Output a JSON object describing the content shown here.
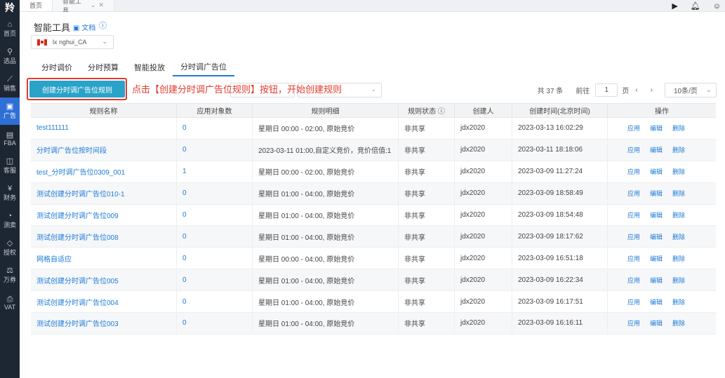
{
  "sidebar": {
    "logo": "羚",
    "items": [
      {
        "icon": "⌂",
        "label": "首页",
        "active": false
      },
      {
        "icon": "⚲",
        "label": "选品",
        "active": false
      },
      {
        "icon": "⟋",
        "label": "销售",
        "active": false
      },
      {
        "icon": "▣",
        "label": "广告",
        "active": true
      },
      {
        "icon": "▤",
        "label": "FBA",
        "active": false
      },
      {
        "icon": "◫",
        "label": "客服",
        "active": false
      },
      {
        "icon": "¥",
        "label": "财务",
        "active": false
      },
      {
        "icon": "◔",
        "label": "测卖",
        "active": false
      },
      {
        "icon": "◇",
        "label": "授权",
        "active": false
      },
      {
        "icon": "⚖",
        "label": "万券",
        "active": false
      },
      {
        "icon": "⎙",
        "label": "VAT",
        "active": false
      }
    ]
  },
  "topbar": {
    "tabs": [
      {
        "label": "首页"
      },
      {
        "label": "智能工具",
        "close": "✕"
      }
    ]
  },
  "page": {
    "title": "智能工具",
    "doc_link": "文档",
    "store_select": "lx nghui_CA"
  },
  "subtabs": [
    "分时调价",
    "分时预算",
    "智能投放",
    "分时调广告位"
  ],
  "toolbar": {
    "create_button": "创建分时调广告位规则",
    "annotation": "点击【创建分时调广告位规则】按钮，开始创建规则"
  },
  "pager": {
    "total": "共 37 条",
    "goto_label": "前往",
    "page_value": "1",
    "page_unit": "页",
    "prev": "‹",
    "next": "›",
    "page_size": "10条/页"
  },
  "table": {
    "headers": [
      "规则名称",
      "应用对象数",
      "规则明细",
      "规则状态 ⓘ",
      "创建人",
      "创建时间(北京时间)",
      "操作"
    ],
    "rows": [
      {
        "name": "test111111",
        "count": "0",
        "detail": "星期日 00:00 - 02:00, 原始竞价",
        "status": "非共享",
        "creator": "jdx2020",
        "created": "2023-03-13 16:02:29"
      },
      {
        "name": "分时调广告位按时间段",
        "count": "0",
        "detail": "2023-03-11 01:00,自定义竞价，竞价倍值:1",
        "status": "非共享",
        "creator": "jdx2020",
        "created": "2023-03-11 18:18:06"
      },
      {
        "name": "test_分时调广告位0309_001",
        "count": "1",
        "detail": "星期日 00:00 - 02:00, 原始竞价",
        "status": "非共享",
        "creator": "jdx2020",
        "created": "2023-03-09 11:27:24"
      },
      {
        "name": "测试创建分时调广告位010-1",
        "count": "0",
        "detail": "星期日 01:00 - 04:00, 原始竞价",
        "status": "非共享",
        "creator": "jdx2020",
        "created": "2023-03-09 18:58:49"
      },
      {
        "name": "测试创建分时调广告位009",
        "count": "0",
        "detail": "星期日 01:00 - 04:00, 原始竞价",
        "status": "非共享",
        "creator": "jdx2020",
        "created": "2023-03-09 18:54:48"
      },
      {
        "name": "测试创建分时调广告位008",
        "count": "0",
        "detail": "星期日 01:00 - 04:00, 原始竞价",
        "status": "非共享",
        "creator": "jdx2020",
        "created": "2023-03-09 18:17:62"
      },
      {
        "name": "网格自适应",
        "count": "0",
        "detail": "星期日 00:00 - 04:00, 原始竞价",
        "status": "非共享",
        "creator": "jdx2020",
        "created": "2023-03-09 16:51:18"
      },
      {
        "name": "测试创建分时调广告位005",
        "count": "0",
        "detail": "星期日 01:00 - 04:00, 原始竞价",
        "status": "非共享",
        "creator": "jdx2020",
        "created": "2023-03-09 16:22:34"
      },
      {
        "name": "测试创建分时调广告位004",
        "count": "0",
        "detail": "星期日 01:00 - 04:00, 原始竞价",
        "status": "非共享",
        "creator": "jdx2020",
        "created": "2023-03-09 16:17:51"
      },
      {
        "name": "测试创建分时调广告位003",
        "count": "0",
        "detail": "星期日 01:00 - 04:00, 原始竞价",
        "status": "非共享",
        "creator": "jdx2020",
        "created": "2023-03-09 16:16:11"
      }
    ],
    "ops": [
      "应用",
      "编辑",
      "删除"
    ]
  }
}
